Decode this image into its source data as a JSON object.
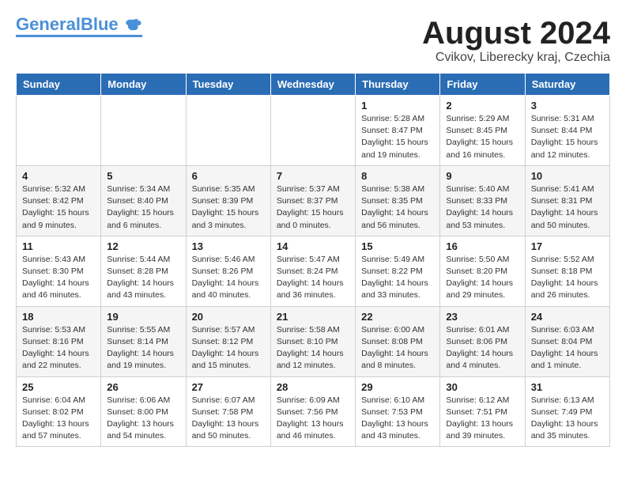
{
  "header": {
    "logo_general": "General",
    "logo_blue": "Blue",
    "month_title": "August 2024",
    "location": "Cvikov, Liberecky kraj, Czechia"
  },
  "days_of_week": [
    "Sunday",
    "Monday",
    "Tuesday",
    "Wednesday",
    "Thursday",
    "Friday",
    "Saturday"
  ],
  "weeks": [
    [
      {
        "num": "",
        "info": ""
      },
      {
        "num": "",
        "info": ""
      },
      {
        "num": "",
        "info": ""
      },
      {
        "num": "",
        "info": ""
      },
      {
        "num": "1",
        "info": "Sunrise: 5:28 AM\nSunset: 8:47 PM\nDaylight: 15 hours\nand 19 minutes."
      },
      {
        "num": "2",
        "info": "Sunrise: 5:29 AM\nSunset: 8:45 PM\nDaylight: 15 hours\nand 16 minutes."
      },
      {
        "num": "3",
        "info": "Sunrise: 5:31 AM\nSunset: 8:44 PM\nDaylight: 15 hours\nand 12 minutes."
      }
    ],
    [
      {
        "num": "4",
        "info": "Sunrise: 5:32 AM\nSunset: 8:42 PM\nDaylight: 15 hours\nand 9 minutes."
      },
      {
        "num": "5",
        "info": "Sunrise: 5:34 AM\nSunset: 8:40 PM\nDaylight: 15 hours\nand 6 minutes."
      },
      {
        "num": "6",
        "info": "Sunrise: 5:35 AM\nSunset: 8:39 PM\nDaylight: 15 hours\nand 3 minutes."
      },
      {
        "num": "7",
        "info": "Sunrise: 5:37 AM\nSunset: 8:37 PM\nDaylight: 15 hours\nand 0 minutes."
      },
      {
        "num": "8",
        "info": "Sunrise: 5:38 AM\nSunset: 8:35 PM\nDaylight: 14 hours\nand 56 minutes."
      },
      {
        "num": "9",
        "info": "Sunrise: 5:40 AM\nSunset: 8:33 PM\nDaylight: 14 hours\nand 53 minutes."
      },
      {
        "num": "10",
        "info": "Sunrise: 5:41 AM\nSunset: 8:31 PM\nDaylight: 14 hours\nand 50 minutes."
      }
    ],
    [
      {
        "num": "11",
        "info": "Sunrise: 5:43 AM\nSunset: 8:30 PM\nDaylight: 14 hours\nand 46 minutes."
      },
      {
        "num": "12",
        "info": "Sunrise: 5:44 AM\nSunset: 8:28 PM\nDaylight: 14 hours\nand 43 minutes."
      },
      {
        "num": "13",
        "info": "Sunrise: 5:46 AM\nSunset: 8:26 PM\nDaylight: 14 hours\nand 40 minutes."
      },
      {
        "num": "14",
        "info": "Sunrise: 5:47 AM\nSunset: 8:24 PM\nDaylight: 14 hours\nand 36 minutes."
      },
      {
        "num": "15",
        "info": "Sunrise: 5:49 AM\nSunset: 8:22 PM\nDaylight: 14 hours\nand 33 minutes."
      },
      {
        "num": "16",
        "info": "Sunrise: 5:50 AM\nSunset: 8:20 PM\nDaylight: 14 hours\nand 29 minutes."
      },
      {
        "num": "17",
        "info": "Sunrise: 5:52 AM\nSunset: 8:18 PM\nDaylight: 14 hours\nand 26 minutes."
      }
    ],
    [
      {
        "num": "18",
        "info": "Sunrise: 5:53 AM\nSunset: 8:16 PM\nDaylight: 14 hours\nand 22 minutes."
      },
      {
        "num": "19",
        "info": "Sunrise: 5:55 AM\nSunset: 8:14 PM\nDaylight: 14 hours\nand 19 minutes."
      },
      {
        "num": "20",
        "info": "Sunrise: 5:57 AM\nSunset: 8:12 PM\nDaylight: 14 hours\nand 15 minutes."
      },
      {
        "num": "21",
        "info": "Sunrise: 5:58 AM\nSunset: 8:10 PM\nDaylight: 14 hours\nand 12 minutes."
      },
      {
        "num": "22",
        "info": "Sunrise: 6:00 AM\nSunset: 8:08 PM\nDaylight: 14 hours\nand 8 minutes."
      },
      {
        "num": "23",
        "info": "Sunrise: 6:01 AM\nSunset: 8:06 PM\nDaylight: 14 hours\nand 4 minutes."
      },
      {
        "num": "24",
        "info": "Sunrise: 6:03 AM\nSunset: 8:04 PM\nDaylight: 14 hours\nand 1 minute."
      }
    ],
    [
      {
        "num": "25",
        "info": "Sunrise: 6:04 AM\nSunset: 8:02 PM\nDaylight: 13 hours\nand 57 minutes."
      },
      {
        "num": "26",
        "info": "Sunrise: 6:06 AM\nSunset: 8:00 PM\nDaylight: 13 hours\nand 54 minutes."
      },
      {
        "num": "27",
        "info": "Sunrise: 6:07 AM\nSunset: 7:58 PM\nDaylight: 13 hours\nand 50 minutes."
      },
      {
        "num": "28",
        "info": "Sunrise: 6:09 AM\nSunset: 7:56 PM\nDaylight: 13 hours\nand 46 minutes."
      },
      {
        "num": "29",
        "info": "Sunrise: 6:10 AM\nSunset: 7:53 PM\nDaylight: 13 hours\nand 43 minutes."
      },
      {
        "num": "30",
        "info": "Sunrise: 6:12 AM\nSunset: 7:51 PM\nDaylight: 13 hours\nand 39 minutes."
      },
      {
        "num": "31",
        "info": "Sunrise: 6:13 AM\nSunset: 7:49 PM\nDaylight: 13 hours\nand 35 minutes."
      }
    ]
  ]
}
